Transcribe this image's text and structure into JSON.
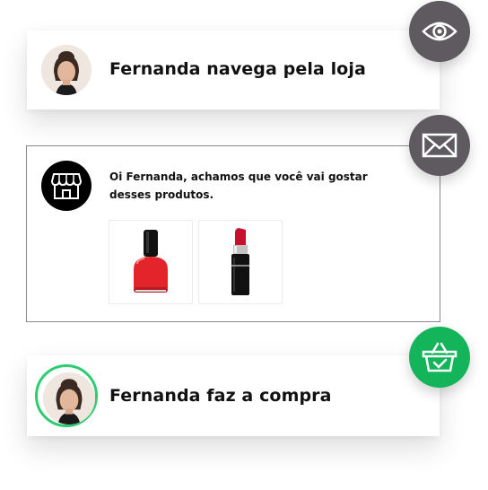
{
  "colors": {
    "fab_gray": "#5f5a60",
    "fab_green": "#13b45a",
    "avatar_ring": "#2ecc71"
  },
  "step_view": {
    "icon": "eye-icon",
    "title": "Fernanda navega pela loja"
  },
  "step_email": {
    "icon": "mail-icon",
    "store_icon": "store-icon",
    "message": "Oi Fernanda, achamos que você vai gostar desses produtos.",
    "products": [
      {
        "name": "nail-polish-image"
      },
      {
        "name": "lipstick-image"
      }
    ]
  },
  "step_purchase": {
    "icon": "shopping-basket-check-icon",
    "title": "Fernanda faz a compra"
  }
}
